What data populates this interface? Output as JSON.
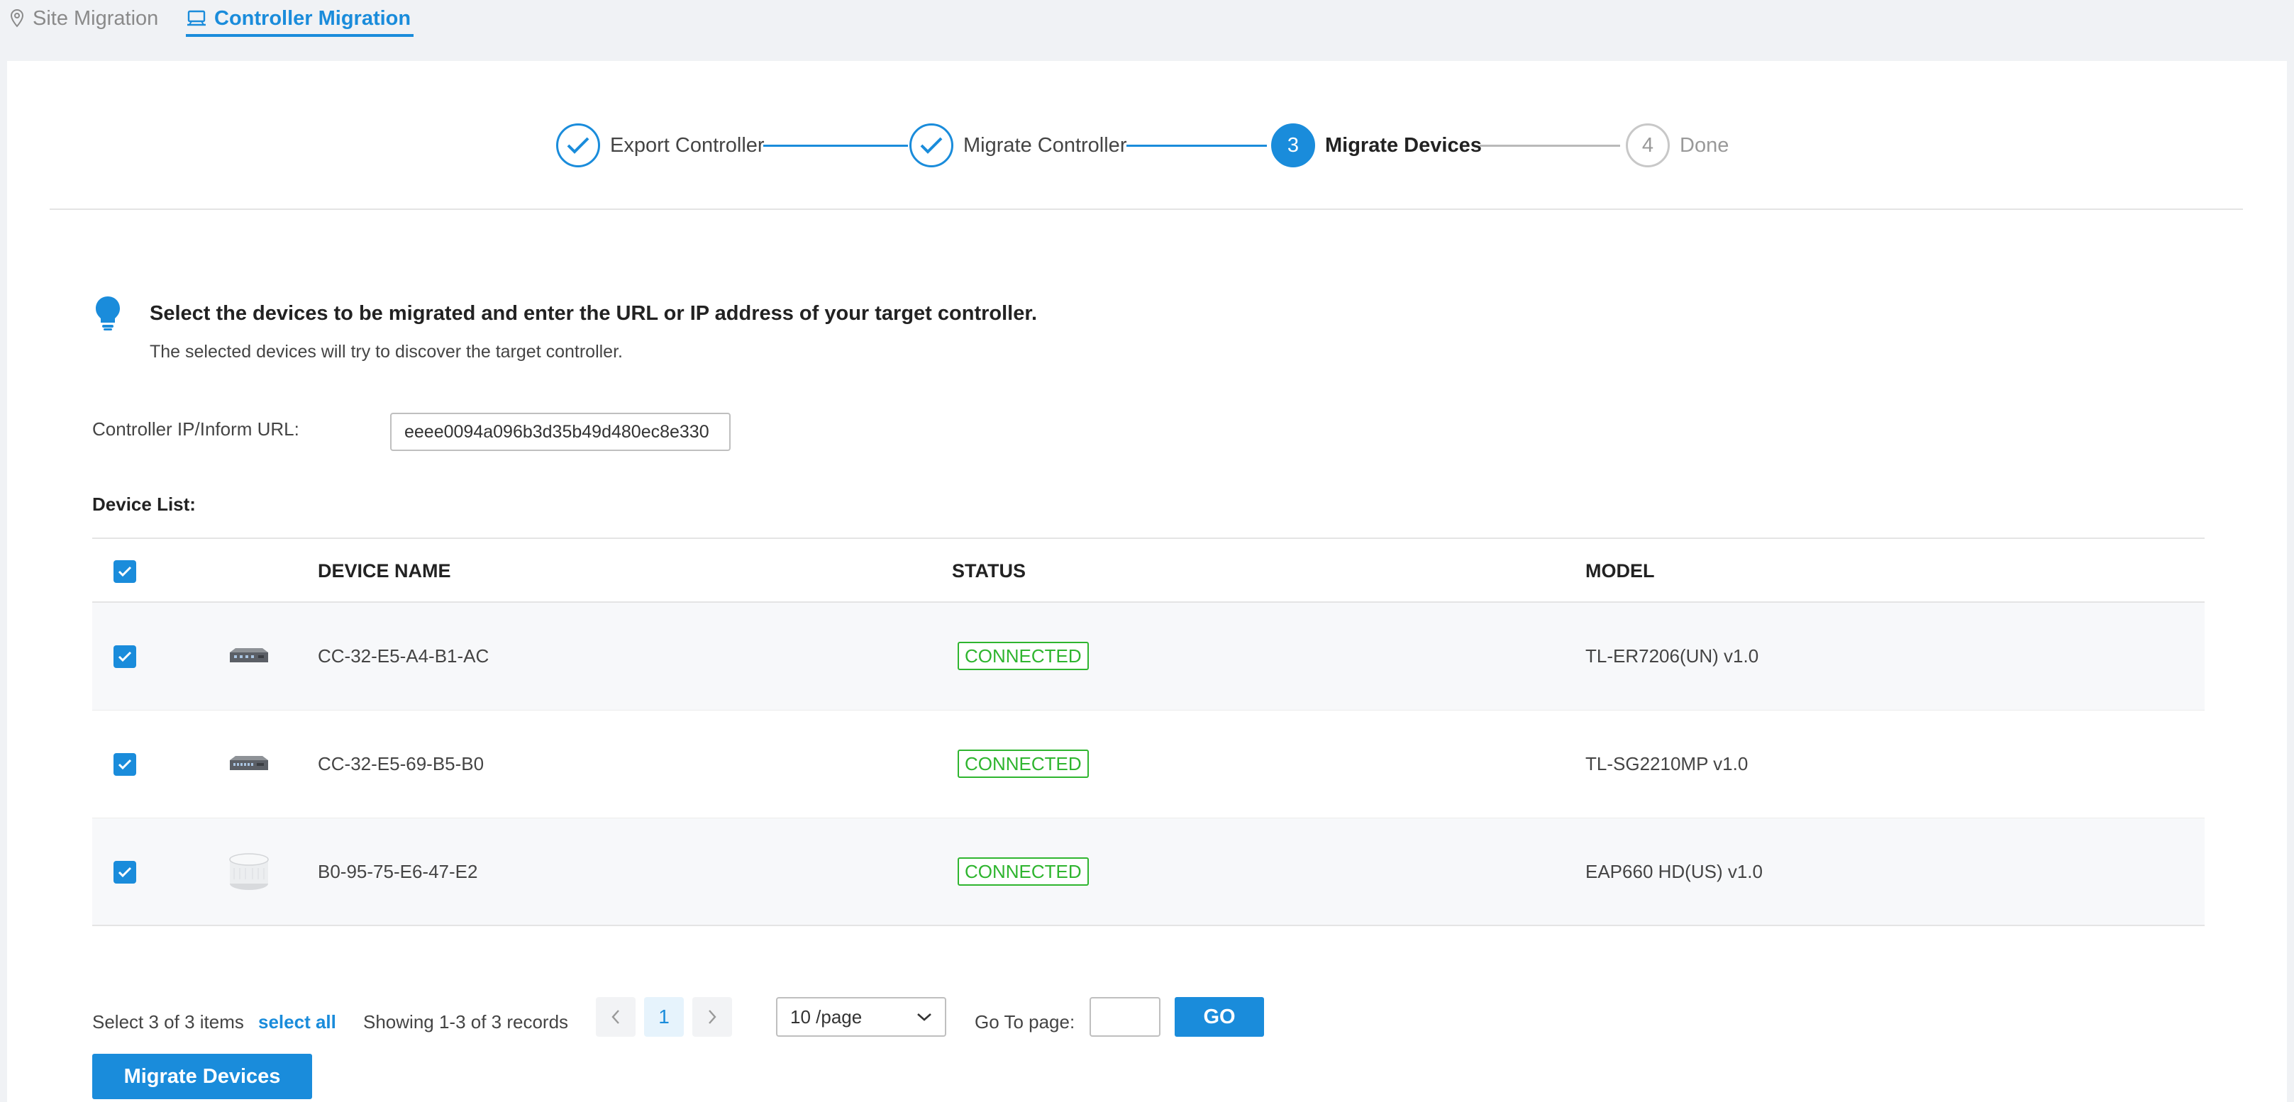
{
  "tabs": [
    {
      "label": "Site Migration",
      "icon": "location-pin-icon"
    },
    {
      "label": "Controller Migration",
      "icon": "controller-icon"
    }
  ],
  "colors": {
    "accent": "#1a8cdb",
    "connected": "#2fb52f"
  },
  "steps": [
    {
      "number": "1",
      "label": "Export Controller",
      "state": "done"
    },
    {
      "number": "2",
      "label": "Migrate Controller",
      "state": "done"
    },
    {
      "number": "3",
      "label": "Migrate Devices",
      "state": "active"
    },
    {
      "number": "4",
      "label": "Done",
      "state": "pending"
    }
  ],
  "hint": {
    "title": "Select the devices to be migrated and enter the URL or IP address of your target controller.",
    "subtitle": "The selected devices will try to discover the target controller."
  },
  "controller_url": {
    "label": "Controller IP/Inform URL:",
    "value": "eeee0094a096b3d35b49d480ec8e330"
  },
  "device_list_label": "Device List:",
  "table": {
    "headers": {
      "name": "DEVICE NAME",
      "status": "STATUS",
      "model": "MODEL"
    },
    "rows": [
      {
        "name": "CC-32-E5-A4-B1-AC",
        "status": "CONNECTED",
        "model": "TL-ER7206(UN) v1.0",
        "icon": "router-icon"
      },
      {
        "name": "CC-32-E5-69-B5-B0",
        "status": "CONNECTED",
        "model": "TL-SG2210MP v1.0",
        "icon": "switch-icon"
      },
      {
        "name": "B0-95-75-E6-47-E2",
        "status": "CONNECTED",
        "model": "EAP660 HD(US) v1.0",
        "icon": "access-point-icon"
      }
    ]
  },
  "pagination": {
    "selected_text": "Select 3 of 3 items",
    "select_all": "select all",
    "showing": "Showing 1-3 of 3 records",
    "current_page": "1",
    "per_page": "10 /page",
    "goto_label": "Go To page:",
    "go_label": "GO"
  },
  "migrate_button": "Migrate Devices"
}
